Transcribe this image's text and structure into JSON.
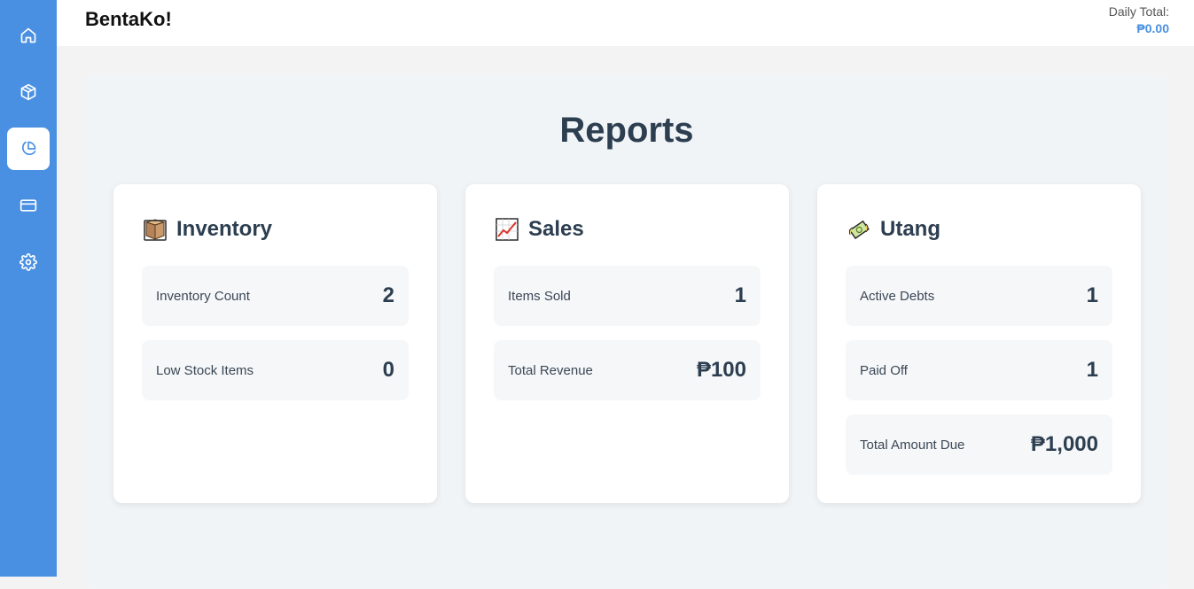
{
  "app": {
    "brand": "BentaKo!"
  },
  "header": {
    "daily_total_label": "Daily Total:",
    "daily_total_value": "₱0.00"
  },
  "sidebar": {
    "items": [
      {
        "name": "home",
        "icon": "home-icon",
        "active": false
      },
      {
        "name": "inventory",
        "icon": "box-icon",
        "active": false
      },
      {
        "name": "reports",
        "icon": "pie-chart-icon",
        "active": true
      },
      {
        "name": "payments",
        "icon": "credit-card-icon",
        "active": false
      },
      {
        "name": "settings",
        "icon": "gear-icon",
        "active": false
      }
    ],
    "accent": "#4a90e2"
  },
  "page": {
    "title": "Reports"
  },
  "cards": [
    {
      "title": "Inventory",
      "icon": "package-icon",
      "stats": [
        {
          "label": "Inventory Count",
          "value": "2"
        },
        {
          "label": "Low Stock Items",
          "value": "0"
        }
      ]
    },
    {
      "title": "Sales",
      "icon": "chart-increasing-icon",
      "stats": [
        {
          "label": "Items Sold",
          "value": "1"
        },
        {
          "label": "Total Revenue",
          "value": "₱100"
        }
      ]
    },
    {
      "title": "Utang",
      "icon": "money-wings-icon",
      "stats": [
        {
          "label": "Active Debts",
          "value": "1"
        },
        {
          "label": "Paid Off",
          "value": "1"
        },
        {
          "label": "Total Amount Due",
          "value": "₱1,000"
        }
      ]
    }
  ]
}
